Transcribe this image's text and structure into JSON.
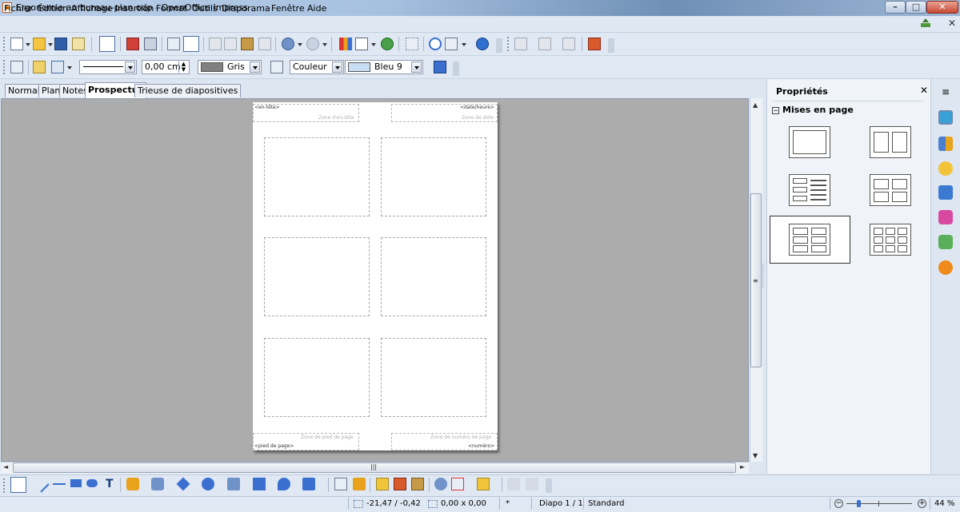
{
  "window": {
    "title": "Ergonomie au bureau-plan.odp - OpenOffice Impress",
    "min_glyph": "–",
    "max_glyph": "□",
    "close_glyph": "✕"
  },
  "menu": {
    "items": [
      "Fichier",
      "Édition",
      "Affichage",
      "Insertion",
      "Format",
      "Outils",
      "Diaporama",
      "Fenêtre",
      "Aide"
    ],
    "close_glyph": "✕"
  },
  "line_toolbar": {
    "line_width_value": "0,00 cm",
    "line_color": {
      "label": "Gris",
      "color": "#808080"
    },
    "area_style": "Couleur",
    "area_color": {
      "label": "Bleu 9",
      "color": "#c9def5"
    }
  },
  "view_tabs": [
    {
      "label": "Normal",
      "active": false
    },
    {
      "label": "Plan",
      "active": false
    },
    {
      "label": "Notes",
      "active": false
    },
    {
      "label": "Prospectus",
      "active": true
    },
    {
      "label": "Trieuse de diapositives",
      "active": false
    }
  ],
  "handout": {
    "header_label": "<en-tête>",
    "header_hint": "Zone d'en-tête",
    "date_label": "<date/heure>",
    "date_hint": "Zone de date",
    "footer_label": "<pied de page>",
    "footer_hint": "Zone de pied de page",
    "number_label": "<numéro>",
    "number_hint": "Zone de numéro de page"
  },
  "scroll_glyphs": {
    "up": "▲",
    "down": "▼",
    "left": "◄",
    "right": "►",
    "grip_h": "|||",
    "grip_v": "≡"
  },
  "sidebar": {
    "title": "Propriétés",
    "close_glyph": "✕",
    "menu_glyph": "≡",
    "deck_title": "Mises en page",
    "deck_expander": "−"
  },
  "status": {
    "position": "-21,47 / -0,42",
    "size": "0,00 x 0,00",
    "modified": "*",
    "slide": "Diapo 1 / 1",
    "master": "Standard",
    "zoom": "44 %"
  }
}
